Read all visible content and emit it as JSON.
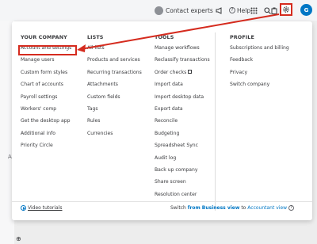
{
  "topbar": {
    "contact_experts": "Contact experts",
    "help_label": "Help",
    "user_initial": "G",
    "icons": [
      "megaphone-icon",
      "help-icon",
      "apps-grid-icon",
      "search-icon",
      "notifications-icon",
      "gear-icon"
    ]
  },
  "menu": {
    "columns": [
      {
        "header": "YOUR COMPANY",
        "items": [
          "Account and settings",
          "Manage users",
          "Custom form styles",
          "Chart of accounts",
          "Payroll settings",
          "Workers' comp",
          "Get the desktop app",
          "Additional info",
          "Priority Circle"
        ]
      },
      {
        "header": "LISTS",
        "items": [
          "All lists",
          "Products and services",
          "Recurring transactions",
          "Attachments",
          "Custom fields",
          "Tags",
          "Rules",
          "Currencies"
        ]
      },
      {
        "header": "TOOLS",
        "items": [
          "Manage workflows",
          "Reclassify transactions",
          "Order checks",
          "Import data",
          "Import desktop data",
          "Export data",
          "Reconcile",
          "Budgeting",
          "Spreadsheet Sync",
          "Audit log",
          "Back up company",
          "Share screen",
          "Resolution center"
        ]
      },
      {
        "header": "PROFILE",
        "items": [
          "Subscriptions and billing",
          "Feedback",
          "Privacy",
          "Switch company"
        ]
      }
    ],
    "video_tutorials": "Video tutorials",
    "switch_text": {
      "prefix": "Switch ",
      "from": "from Business view",
      "to": " to ",
      "target": "Accountant view"
    }
  },
  "colors": {
    "accent": "#0077c5",
    "annotation_red": "#d52b1e"
  }
}
